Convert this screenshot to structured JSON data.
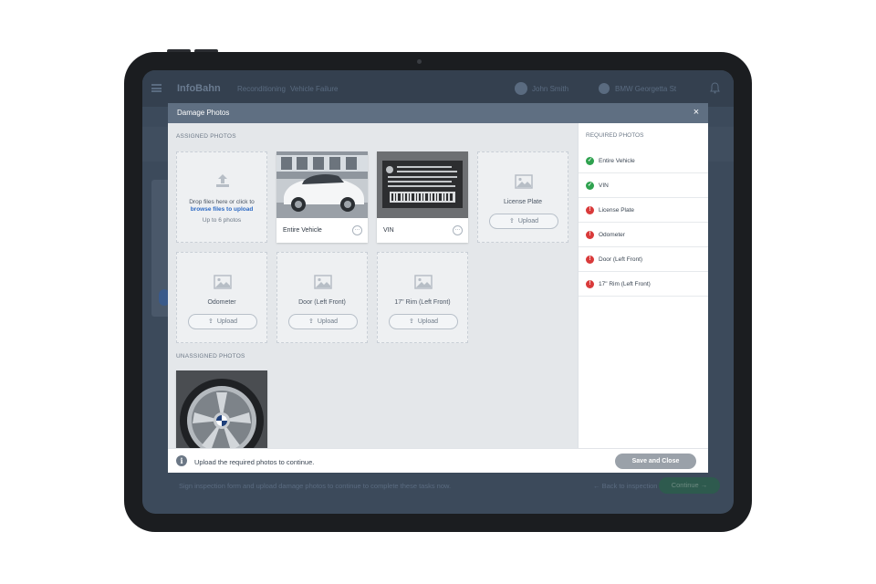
{
  "app": {
    "logo": "InfoBahn",
    "breadcrumb": [
      "Reconditioning",
      "Vehicle Failure"
    ],
    "user_name": "John Smith",
    "dealer_name": "BMW Georgetta St"
  },
  "background_footer": {
    "instruction": "Sign inspection form and upload damage photos to continue to complete these tasks now.",
    "back_label": "← Back to inspection",
    "continue_label": "Continue →"
  },
  "modal": {
    "title": "Damage Photos",
    "close_icon": "×",
    "assigned_label": "ASSIGNED PHOTOS",
    "unassigned_label": "UNASSIGNED PHOTOS",
    "dropzone": {
      "text": "Drop files here or click to",
      "link": "browse files to upload",
      "limit": "Up to 6 photos"
    },
    "photo_tiles": [
      {
        "label": "Entire Vehicle",
        "more": "···"
      },
      {
        "label": "VIN",
        "more": "···"
      }
    ],
    "empty_tiles": [
      {
        "label": "License Plate",
        "upload": "Upload"
      },
      {
        "label": "Odometer",
        "upload": "Upload"
      },
      {
        "label": "Door (Left Front)",
        "upload": "Upload"
      },
      {
        "label": "17\" Rim (Left Front)",
        "upload": "Upload"
      }
    ],
    "required": {
      "title": "REQUIRED PHOTOS",
      "items": [
        {
          "label": "Entire Vehicle",
          "status": "complete",
          "glyph": "✓"
        },
        {
          "label": "VIN",
          "status": "complete",
          "glyph": "✓"
        },
        {
          "label": "License Plate",
          "status": "missing",
          "glyph": "!"
        },
        {
          "label": "Odometer",
          "status": "missing",
          "glyph": "!"
        },
        {
          "label": "Door (Left Front)",
          "status": "missing",
          "glyph": "!"
        },
        {
          "label": "17\" Rim (Left Front)",
          "status": "missing",
          "glyph": "!"
        }
      ]
    },
    "footer": {
      "info_glyph": "i",
      "message": "Upload the required photos to continue.",
      "save_label": "Save and Close"
    }
  },
  "colors": {
    "modal_header": "#5f6f82",
    "link_blue": "#2d6ac4",
    "success_green": "#2fa24f",
    "error_red": "#d93a3a",
    "save_disabled": "#9aa1a9"
  }
}
